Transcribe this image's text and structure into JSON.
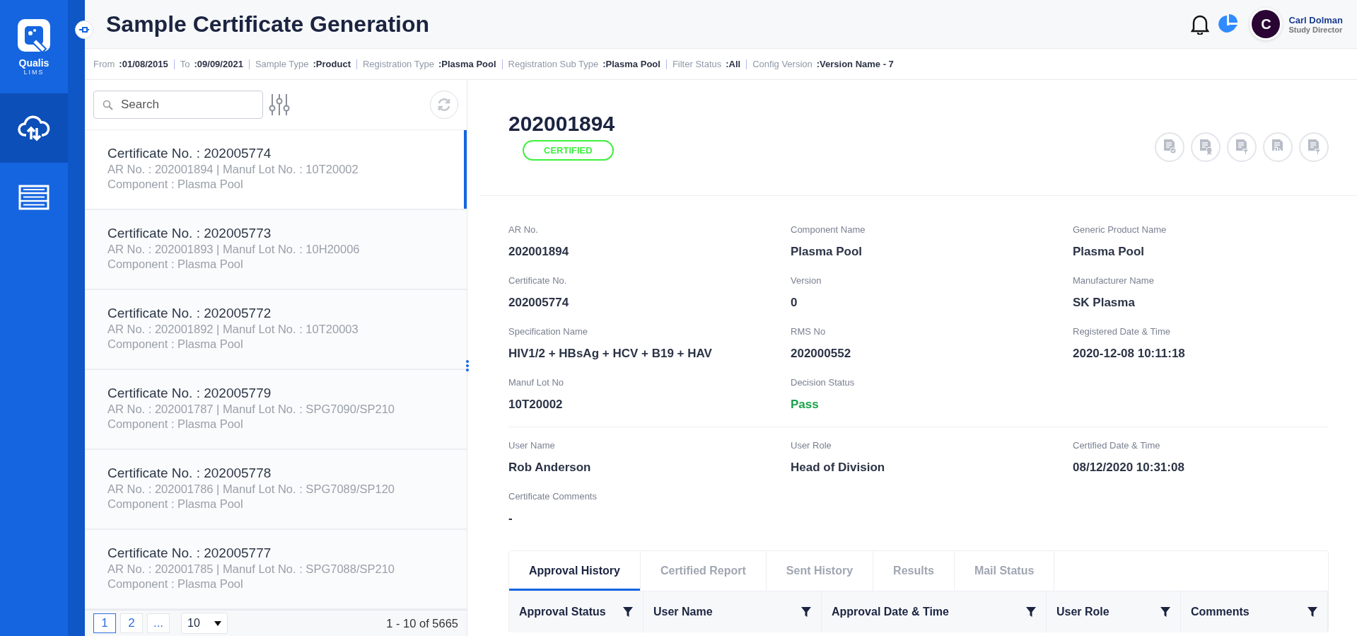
{
  "app": {
    "logo_name": "Qualis",
    "logo_sub": "LIMS"
  },
  "nav": [
    {
      "kind": "cloud",
      "selected": true
    },
    {
      "kind": "list",
      "selected": false
    }
  ],
  "header": {
    "title": "Sample Certificate Generation",
    "user": {
      "initial": "C",
      "name": "Carl Dolman",
      "role": "Study Director"
    }
  },
  "filters": [
    {
      "label": "From",
      "value": ":01/08/2015"
    },
    {
      "label": "To",
      "value": ":09/09/2021"
    },
    {
      "label": "Sample Type",
      "value": ":Product"
    },
    {
      "label": "Registration Type",
      "value": ":Plasma Pool"
    },
    {
      "label": "Registration Sub Type",
      "value": ":Plasma Pool"
    },
    {
      "label": "Filter Status",
      "value": ":All"
    },
    {
      "label": "Config Version",
      "value": ":Version Name - 7"
    }
  ],
  "search": {
    "placeholder": "Search"
  },
  "certificates": [
    {
      "title": "Certificate No. : 202005774",
      "line1": "AR No. : 202001894 | Manuf Lot No. : 10T20002",
      "line2": "Component : Plasma Pool",
      "selected": true
    },
    {
      "title": "Certificate No. : 202005773",
      "line1": "AR No. : 202001893 | Manuf Lot No. : 10H20006",
      "line2": "Component : Plasma Pool",
      "selected": false
    },
    {
      "title": "Certificate No. : 202005772",
      "line1": "AR No. : 202001892 | Manuf Lot No. : 10T20003",
      "line2": "Component : Plasma Pool",
      "selected": false
    },
    {
      "title": "Certificate No. : 202005779",
      "line1": "AR No. : 202001787 | Manuf Lot No. : SPG7090/SP210",
      "line2": "Component : Plasma Pool",
      "selected": false
    },
    {
      "title": "Certificate No. : 202005778",
      "line1": "AR No. : 202001786 | Manuf Lot No. : SPG7089/SP120",
      "line2": "Component : Plasma Pool",
      "selected": false
    },
    {
      "title": "Certificate No. : 202005777",
      "line1": "AR No. : 202001785 | Manuf Lot No. : SPG7088/SP210",
      "line2": "Component : Plasma Pool",
      "selected": false
    }
  ],
  "pagination": {
    "pages": [
      {
        "label": "1",
        "selected": true
      },
      {
        "label": "2",
        "selected": false
      },
      {
        "label": "...",
        "selected": false
      }
    ],
    "page_size": "10",
    "range": "1 - 10 of 5665"
  },
  "detail": {
    "number": "202001894",
    "status_badge": "CERTIFIED",
    "fields": [
      {
        "label": "AR No.",
        "value": "202001894",
        "kind": "text"
      },
      {
        "label": "Component Name",
        "value": "Plasma Pool",
        "kind": "text"
      },
      {
        "label": "Generic Product Name",
        "value": "Plasma Pool",
        "kind": "text"
      },
      {
        "label": "Certificate No.",
        "value": "202005774",
        "kind": "text"
      },
      {
        "label": "Version",
        "value": "0",
        "kind": "text"
      },
      {
        "label": "Manufacturer Name",
        "value": "SK Plasma",
        "kind": "text"
      },
      {
        "label": "Specification Name",
        "value": "HIV1/2 + HBsAg + HCV + B19 + HAV",
        "kind": "text"
      },
      {
        "label": "RMS No",
        "value": "202000552",
        "kind": "text"
      },
      {
        "label": "Registered Date & Time",
        "value": "2020-12-08 10:11:18",
        "kind": "text"
      },
      {
        "label": "Manuf Lot No",
        "value": "10T20002",
        "kind": "text"
      },
      {
        "label": "Decision Status",
        "value": "Pass",
        "kind": "status"
      }
    ],
    "certification": [
      {
        "label": "User Name",
        "value": "Rob Anderson"
      },
      {
        "label": "User Role",
        "value": "Head of Division"
      },
      {
        "label": "Certified Date & Time",
        "value": "08/12/2020 10:31:08"
      },
      {
        "label": "Certificate Comments",
        "value": "-"
      }
    ],
    "tabs": [
      {
        "label": "Approval History",
        "selected": true
      },
      {
        "label": "Certified Report",
        "selected": false
      },
      {
        "label": "Sent History",
        "selected": false
      },
      {
        "label": "Results",
        "selected": false
      },
      {
        "label": "Mail Status",
        "selected": false
      }
    ],
    "table": {
      "columns": [
        "Approval Status",
        "User Name",
        "Approval Date & Time",
        "User Role",
        "Comments"
      ]
    }
  }
}
